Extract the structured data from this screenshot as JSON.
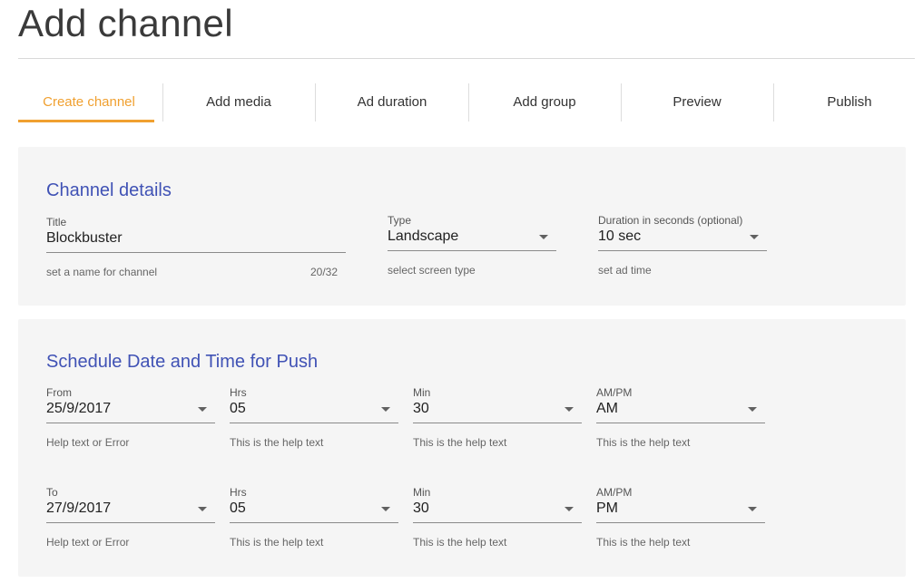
{
  "page": {
    "title": "Add channel"
  },
  "steps": [
    {
      "label": "Create channel",
      "active": true
    },
    {
      "label": "Add media",
      "active": false
    },
    {
      "label": "Ad duration",
      "active": false
    },
    {
      "label": "Add group",
      "active": false
    },
    {
      "label": "Preview",
      "active": false
    },
    {
      "label": "Publish",
      "active": false
    }
  ],
  "colors": {
    "accent": "#f0a030",
    "section_title": "#4052b5",
    "card_bg": "#f5f5f5"
  },
  "channel_details": {
    "title": "Channel details",
    "title_field": {
      "label": "Title",
      "value": "Blockbuster",
      "help": "set a name for channel",
      "counter": "20/32"
    },
    "type_field": {
      "label": "Type",
      "value": "Landscape",
      "help": "select screen type",
      "icon": "dropdown-arrow-icon"
    },
    "duration_field": {
      "label": "Duration in seconds (optional)",
      "value": "10 sec",
      "help": "set ad time",
      "icon": "dropdown-arrow-icon"
    }
  },
  "schedule": {
    "title": "Schedule Date and Time for Push",
    "from": {
      "date": {
        "label": "From",
        "value": "25/9/2017",
        "help": "Help text or Error"
      },
      "hrs": {
        "label": "Hrs",
        "value": "05",
        "help": "This is the help text"
      },
      "min": {
        "label": "Min",
        "value": "30",
        "help": "This is the help text"
      },
      "ampm": {
        "label": "AM/PM",
        "value": "AM",
        "help": "This is the help text"
      }
    },
    "to": {
      "date": {
        "label": "To",
        "value": "27/9/2017",
        "help": "Help text or Error"
      },
      "hrs": {
        "label": "Hrs",
        "value": "05",
        "help": "This is the help text"
      },
      "min": {
        "label": "Min",
        "value": "30",
        "help": "This is the help text"
      },
      "ampm": {
        "label": "AM/PM",
        "value": "PM",
        "help": "This is the help text"
      }
    }
  }
}
